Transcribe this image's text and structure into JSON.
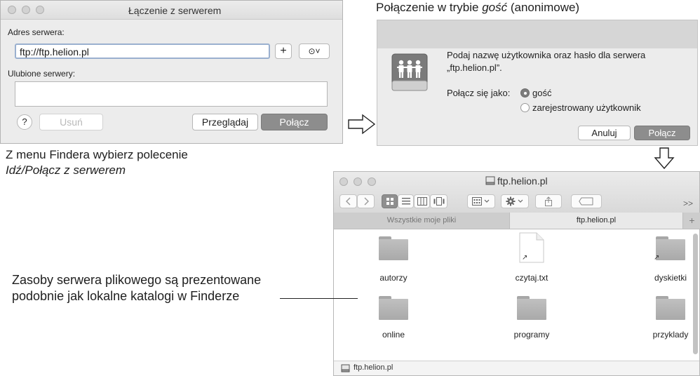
{
  "connect_window": {
    "title": "Łączenie z serwerem",
    "server_address_label": "Adres serwera:",
    "server_address_value": "ftp://ftp.helion.pl",
    "add_label": "+",
    "recent_label": "⊙˅",
    "favorites_label": "Ulubione serwery:",
    "help_label": "?",
    "remove_label": "Usuń",
    "browse_label": "Przeglądaj",
    "connect_label": "Połącz"
  },
  "guest_dialog": {
    "heading_prefix": "Połączenie w trybie ",
    "heading_em": "gość",
    "heading_suffix": " (anonimowe)",
    "message_line1": "Podaj nazwę użytkownika oraz hasło dla serwera",
    "message_line2": "„ftp.helion.pl”.",
    "connect_as_label": "Połącz się jako:",
    "option_guest": "gość",
    "option_registered": "zarejestrowany użytkownik",
    "cancel_label": "Anuluj",
    "connect_label": "Połącz"
  },
  "caption_left": {
    "line1": "Z menu Findera wybierz polecenie",
    "line2": "Idź/Połącz z serwerem"
  },
  "caption_bottom": {
    "line1": "Zasoby serwera plikowego są prezentowane",
    "line2": "podobnie jak lokalne katalogi w Finderze"
  },
  "finder": {
    "title": "ftp.helion.pl",
    "more_label": ">>",
    "tabs": [
      "Wszystkie moje pliki",
      "ftp.helion.pl"
    ],
    "new_tab_label": "+",
    "files": [
      "autorzy",
      "czytaj.txt",
      "dyskietki",
      "online",
      "programy",
      "przyklady"
    ],
    "statusbar_path": "ftp.helion.pl"
  }
}
